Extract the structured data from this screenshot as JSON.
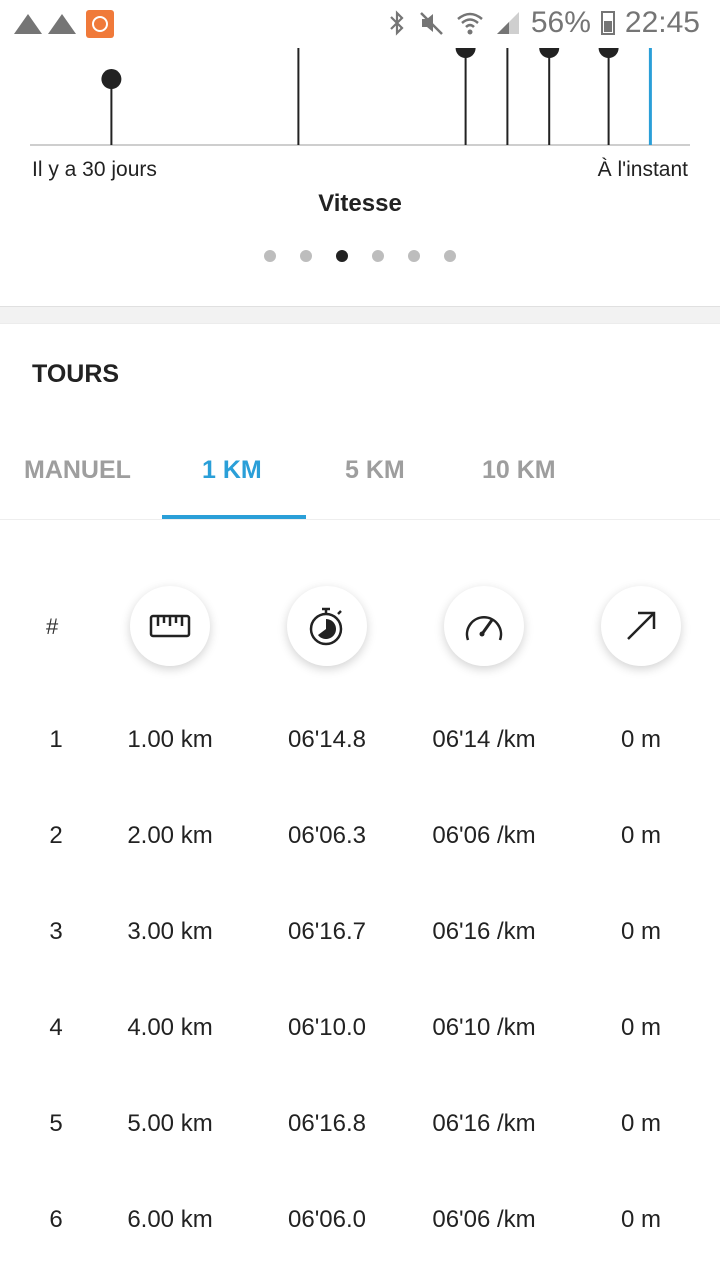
{
  "status_bar": {
    "battery": "56%",
    "time": "22:45"
  },
  "chart_data": {
    "type": "bar",
    "title": "Vitesse",
    "xlabel_left": "Il y a 30 jours",
    "xlabel_right": "À l'instant",
    "x": [
      3.7,
      12.2,
      19.8,
      21.7,
      23.6,
      26.3,
      28.2
    ],
    "values": [
      0.68,
      1.0,
      1.0,
      1.0,
      1.0,
      1.0,
      1.0
    ],
    "markers": [
      true,
      false,
      true,
      false,
      true,
      true,
      false
    ],
    "highlight_last": true,
    "xlim": [
      0,
      30
    ],
    "ylim": [
      0,
      1
    ],
    "grid": false,
    "colors": {
      "line": "#222222",
      "highlight": "#2a9fd8",
      "axis": "#bdbdbd"
    }
  },
  "pager": {
    "count": 6,
    "active": 2
  },
  "tours": {
    "title": "TOURS",
    "tabs": [
      "MANUEL",
      "1 KM",
      "5 KM",
      "10 KM"
    ],
    "active_tab": 1,
    "header_hash": "#",
    "header_icons": [
      "ruler-icon",
      "stopwatch-icon",
      "speedometer-icon",
      "arrow-up-right-icon"
    ],
    "rows": [
      {
        "num": "1",
        "distance": "1.00 km",
        "time": "06'14.8",
        "pace": "06'14 /km",
        "ascent": "0 m"
      },
      {
        "num": "2",
        "distance": "2.00 km",
        "time": "06'06.3",
        "pace": "06'06 /km",
        "ascent": "0 m"
      },
      {
        "num": "3",
        "distance": "3.00 km",
        "time": "06'16.7",
        "pace": "06'16 /km",
        "ascent": "0 m"
      },
      {
        "num": "4",
        "distance": "4.00 km",
        "time": "06'10.0",
        "pace": "06'10 /km",
        "ascent": "0 m"
      },
      {
        "num": "5",
        "distance": "5.00 km",
        "time": "06'16.8",
        "pace": "06'16 /km",
        "ascent": "0 m"
      },
      {
        "num": "6",
        "distance": "6.00 km",
        "time": "06'06.0",
        "pace": "06'06 /km",
        "ascent": "0 m"
      }
    ]
  },
  "colors": {
    "accent": "#2a9fd8",
    "inactive_tab": "#9e9e9e",
    "text": "#222222"
  }
}
